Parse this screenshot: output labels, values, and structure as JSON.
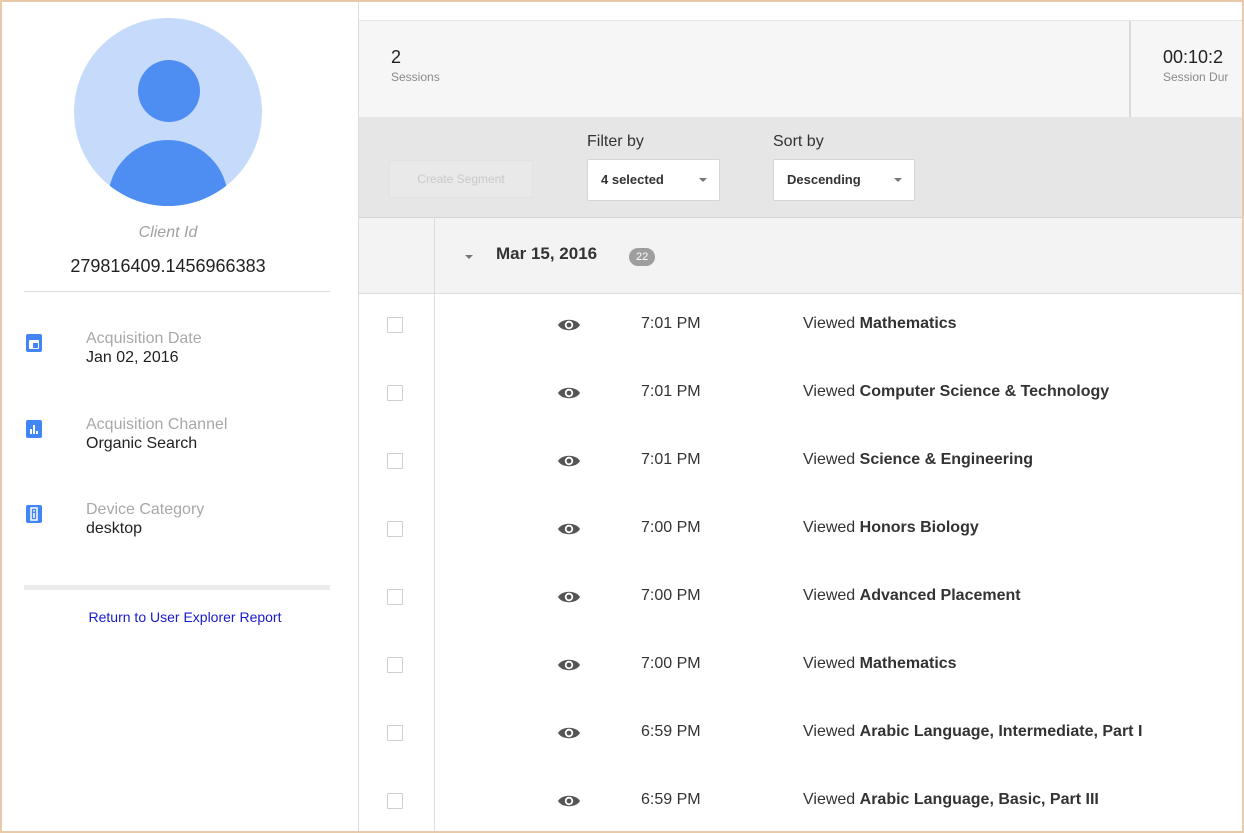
{
  "profile": {
    "client_id_label": "Client Id",
    "client_id": "279816409.1456966383",
    "info": [
      {
        "icon": "calendar-icon",
        "label": "Acquisition Date",
        "value": "Jan 02, 2016"
      },
      {
        "icon": "bar-chart-icon",
        "label": "Acquisition Channel",
        "value": "Organic Search"
      },
      {
        "icon": "device-info-icon",
        "label": "Device Category",
        "value": "desktop"
      }
    ],
    "return_link": "Return to User Explorer Report"
  },
  "stats": {
    "sessions_value": "2",
    "sessions_label": "Sessions",
    "duration_value": "00:10:2",
    "duration_label": "Session Dur"
  },
  "toolbar": {
    "create_segment": "Create Segment",
    "filter_label": "Filter by",
    "filter_value": "4 selected",
    "sort_label": "Sort by",
    "sort_value": "Descending"
  },
  "activity": {
    "date": "Mar 15, 2016",
    "count": "22",
    "viewed_prefix": "Viewed",
    "rows": [
      {
        "time": "7:01 PM",
        "page": "Mathematics"
      },
      {
        "time": "7:01 PM",
        "page": "Computer Science & Technology"
      },
      {
        "time": "7:01 PM",
        "page": "Science & Engineering"
      },
      {
        "time": "7:00 PM",
        "page": "Honors Biology"
      },
      {
        "time": "7:00 PM",
        "page": "Advanced Placement"
      },
      {
        "time": "7:00 PM",
        "page": "Mathematics"
      },
      {
        "time": "6:59 PM",
        "page": "Arabic Language, Intermediate, Part I"
      },
      {
        "time": "6:59 PM",
        "page": "Arabic Language, Basic, Part III"
      }
    ]
  },
  "colors": {
    "accent": "#4285f4",
    "avatar_bg": "#c6dafb",
    "link": "#1a1acd"
  }
}
